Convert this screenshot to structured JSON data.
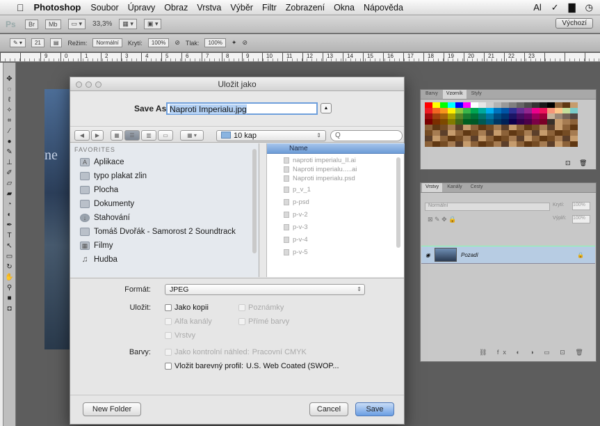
{
  "menubar": {
    "app": "Photoshop",
    "items": [
      "Soubor",
      "Úpravy",
      "Obraz",
      "Vrstva",
      "Výběr",
      "Filtr",
      "Zobrazení",
      "Okna",
      "Nápověda"
    ],
    "status_icons": [
      "Al",
      "✓",
      "▇",
      "◷"
    ]
  },
  "optbar": {
    "logo": "Ps",
    "br": "Br",
    "mb": "Mb",
    "zoom": "33,3%",
    "workspace": "Výchozí"
  },
  "toolopt": {
    "size": "21",
    "mode_label": "Režim:",
    "mode_value": "Normální",
    "opacity_label": "Krytí:",
    "opacity_value": "100%",
    "flow_label": "Tlak:",
    "flow_value": "100%"
  },
  "ruler_numbers": [
    "9",
    "0",
    "1",
    "2",
    "3",
    "4",
    "5",
    "6",
    "7",
    "8",
    "9",
    "10",
    "11",
    "12",
    "13",
    "14",
    "15",
    "16",
    "17",
    "18",
    "19",
    "20",
    "21",
    "22",
    "23"
  ],
  "canvas_text": "ne",
  "swatch_panel": {
    "tabs": [
      "Barvy",
      "Vzorník",
      "Styly"
    ],
    "active_tab": "Vzorník"
  },
  "layers_panel": {
    "tabs": [
      "Vrstvy",
      "Kanály",
      "Cesty"
    ],
    "active_tab": "Vrstvy",
    "blend": "Normální",
    "opacity_label": "Krytí:",
    "opacity": "100%",
    "fill_label": "Výplň:",
    "fill": "100%",
    "layer_name": "Pozadí"
  },
  "dialog": {
    "title": "Uložit jako",
    "save_as_label": "Save As:",
    "filename": "Naproti Imperialu.jpg",
    "folder": "10 kap",
    "search_placeholder": "Q",
    "favorites_heading": "FAVORITES",
    "sidebar": [
      {
        "label": "Aplikace",
        "icon": "apps-icon"
      },
      {
        "label": "typo plakat zlin",
        "icon": "folder-icon"
      },
      {
        "label": "Plocha",
        "icon": "desktop-icon"
      },
      {
        "label": "Dokumenty",
        "icon": "documents-icon"
      },
      {
        "label": "Stahování",
        "icon": "downloads-icon"
      },
      {
        "label": "Tomáš Dvořák - Samorost 2 Soundtrack",
        "icon": "folder-icon"
      },
      {
        "label": "Filmy",
        "icon": "movies-icon"
      },
      {
        "label": "Hudba",
        "icon": "music-icon"
      }
    ],
    "file_header": "Name",
    "files": [
      "naproti imperialu_II.ai",
      "Naproti imperialu.....ai",
      "Naproti imperialu.psd",
      "p_v_1",
      "p-psd",
      "p-v-2",
      "p-v-3",
      "p-v-4",
      "p-v-5"
    ],
    "format_label": "Formát:",
    "format_value": "JPEG",
    "save_label": "Uložit:",
    "opt_copy": "Jako kopii",
    "opt_notes": "Poznámky",
    "opt_alpha": "Alfa kanály",
    "opt_spot": "Přímé barvy",
    "opt_layers": "Vrstvy",
    "colors_label": "Barvy:",
    "opt_proof": "Jako kontrolní náhled:",
    "proof_value": "Pracovní CMYK",
    "opt_profile": "Vložit barevný profil:",
    "profile_value": "U.S. Web Coated (SWOP...",
    "new_folder": "New Folder",
    "cancel": "Cancel",
    "save": "Save"
  },
  "colors": {
    "accent": "#6a9ee3",
    "selection": "#b4d1f4",
    "layer_highlight": "#b7cce3"
  }
}
